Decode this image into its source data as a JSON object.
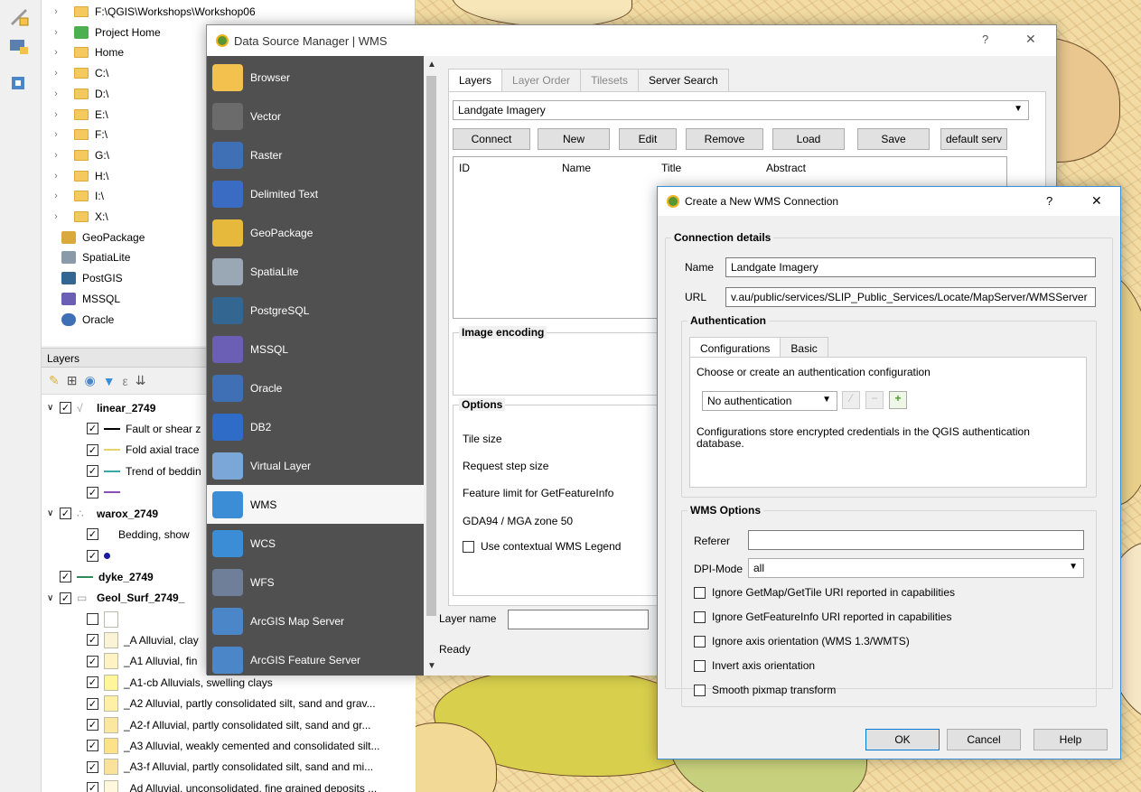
{
  "browser": {
    "items": [
      {
        "label": "F:\\QGIS\\Workshops\\Workshop06",
        "type": "folder",
        "chevron": true
      },
      {
        "label": "Project Home",
        "type": "project",
        "chevron": true
      },
      {
        "label": "Home",
        "type": "folder",
        "chevron": true
      },
      {
        "label": "C:\\",
        "type": "folder",
        "chevron": true
      },
      {
        "label": "D:\\",
        "type": "folder",
        "chevron": true
      },
      {
        "label": "E:\\",
        "type": "folder",
        "chevron": true
      },
      {
        "label": "F:\\",
        "type": "folder",
        "chevron": true
      },
      {
        "label": "G:\\",
        "type": "folder",
        "chevron": true
      },
      {
        "label": "H:\\",
        "type": "folder",
        "chevron": true
      },
      {
        "label": "I:\\",
        "type": "folder",
        "chevron": true
      },
      {
        "label": "X:\\",
        "type": "folder",
        "chevron": true
      },
      {
        "label": "GeoPackage",
        "type": "geopackage",
        "chevron": false
      },
      {
        "label": "SpatiaLite",
        "type": "spatialite",
        "chevron": false
      },
      {
        "label": "PostGIS",
        "type": "postgis",
        "chevron": false
      },
      {
        "label": "MSSQL",
        "type": "mssql",
        "chevron": false
      },
      {
        "label": "Oracle",
        "type": "oracle",
        "chevron": false
      }
    ]
  },
  "layers_panel": {
    "title": "Layers",
    "rows": [
      {
        "label": "linear_2749",
        "indent": 0,
        "bold": true,
        "checked": true,
        "expand": "v",
        "symbol": "group"
      },
      {
        "label": "Fault or shear z",
        "indent": 1,
        "checked": true,
        "symbol": "line-black"
      },
      {
        "label": "Fold axial trace",
        "indent": 1,
        "checked": true,
        "symbol": "line-yellow"
      },
      {
        "label": "Trend of beddin",
        "indent": 1,
        "checked": true,
        "symbol": "line-teal"
      },
      {
        "label": "",
        "indent": 1,
        "checked": true,
        "symbol": "line-purple"
      },
      {
        "label": "warox_2749",
        "indent": 0,
        "bold": true,
        "checked": true,
        "expand": "v",
        "symbol": "points"
      },
      {
        "label": "Bedding, show",
        "indent": 1,
        "checked": true,
        "symbol": "none"
      },
      {
        "label": "",
        "indent": 1,
        "checked": true,
        "symbol": "dot-blue"
      },
      {
        "label": "dyke_2749",
        "indent": 0,
        "bold": true,
        "checked": true,
        "expand": "",
        "symbol": "line-green"
      },
      {
        "label": "Geol_Surf_2749_",
        "indent": 0,
        "bold": true,
        "checked": true,
        "expand": "v",
        "symbol": "poly"
      },
      {
        "label": "",
        "indent": 1,
        "checked": false,
        "symbol": "sw-white"
      },
      {
        "label": "_A Alluvial, clay",
        "indent": 1,
        "checked": true,
        "symbol": "sw-cream"
      },
      {
        "label": "_A1 Alluvial, fin",
        "indent": 1,
        "checked": true,
        "symbol": "sw-cream2"
      },
      {
        "label": "_A1-cb Alluvials, swelling clays",
        "indent": 1,
        "checked": true,
        "symbol": "sw-lines"
      },
      {
        "label": "_A2 Alluvial, partly consolidated silt, sand and grav...",
        "indent": 1,
        "checked": true,
        "symbol": "sw-dots"
      },
      {
        "label": "_A2-f Alluvial, partly consolidated silt, sand and gr...",
        "indent": 1,
        "checked": true,
        "symbol": "sw-dots2"
      },
      {
        "label": "_A3 Alluvial, weakly cemented and consolidated silt...",
        "indent": 1,
        "checked": true,
        "symbol": "sw-yellow"
      },
      {
        "label": "_A3-f Alluvial, partly consolidated silt, sand and mi...",
        "indent": 1,
        "checked": true,
        "symbol": "sw-yellow2"
      },
      {
        "label": "_Ad Alluvial, unconsolidated, fine grained deposits ...",
        "indent": 1,
        "checked": true,
        "symbol": "sw-pale"
      }
    ]
  },
  "dsm": {
    "title": "Data Source Manager | WMS",
    "help": "?",
    "close": "✕",
    "sidebar": [
      {
        "label": "Browser",
        "color": "#f2c14e"
      },
      {
        "label": "Vector",
        "color": "#6b6b6b"
      },
      {
        "label": "Raster",
        "color": "#3f6fb5"
      },
      {
        "label": "Delimited Text",
        "color": "#3b6cc4"
      },
      {
        "label": "GeoPackage",
        "color": "#e6b83b"
      },
      {
        "label": "SpatiaLite",
        "color": "#9aa7b4"
      },
      {
        "label": "PostgreSQL",
        "color": "#336791"
      },
      {
        "label": "MSSQL",
        "color": "#6b5fb5"
      },
      {
        "label": "Oracle",
        "color": "#3f6fb5"
      },
      {
        "label": "DB2",
        "color": "#2f6cc8"
      },
      {
        "label": "Virtual Layer",
        "color": "#7aa6d8"
      },
      {
        "label": "WMS",
        "color": "#3b8ed6"
      },
      {
        "label": "WCS",
        "color": "#3b8ed6"
      },
      {
        "label": "WFS",
        "color": "#6f7f9a"
      },
      {
        "label": "ArcGIS Map Server",
        "color": "#4b86c8"
      },
      {
        "label": "ArcGIS Feature Server",
        "color": "#4b86c8"
      }
    ],
    "active_item": "WMS",
    "tabs": [
      {
        "label": "Layers",
        "state": "sel"
      },
      {
        "label": "Layer Order",
        "state": "dis"
      },
      {
        "label": "Tilesets",
        "state": "dis"
      },
      {
        "label": "Server Search",
        "state": ""
      }
    ],
    "connection": "Landgate Imagery",
    "buttons": [
      "Connect",
      "New",
      "Edit",
      "Remove",
      "Load",
      "Save",
      "default serv"
    ],
    "table_headers": [
      "ID",
      "Name",
      "Title",
      "Abstract"
    ],
    "image_encoding_label": "Image encoding",
    "options_label": "Options",
    "options": [
      "Tile size",
      "Request step size",
      "Feature limit for GetFeatureInfo",
      "GDA94 / MGA zone 50"
    ],
    "contextual_legend": "Use contextual WMS Legend",
    "layer_name_label": "Layer name",
    "status": "Ready"
  },
  "wms": {
    "title": "Create a New WMS Connection",
    "help": "?",
    "close": "✕",
    "connection_details": "Connection details",
    "name_label": "Name",
    "name_value": "Landgate Imagery",
    "url_label": "URL",
    "url_value": "v.au/public/services/SLIP_Public_Services/Locate/MapServer/WMSServer",
    "authentication": "Authentication",
    "auth_tabs": [
      "Configurations",
      "Basic"
    ],
    "auth_prompt": "Choose or create an authentication configuration",
    "auth_select": "No authentication",
    "auth_note": "Configurations store encrypted credentials in the QGIS authentication database.",
    "wms_options": "WMS Options",
    "referer_label": "Referer",
    "referer_value": "",
    "dpi_label": "DPI-Mode",
    "dpi_value": "all",
    "checkboxes": [
      "Ignore GetMap/GetTile URI reported in capabilities",
      "Ignore GetFeatureInfo URI reported in capabilities",
      "Ignore axis orientation (WMS 1.3/WMTS)",
      "Invert axis orientation",
      "Smooth pixmap transform"
    ],
    "ok": "OK",
    "cancel": "Cancel",
    "help_btn": "Help"
  },
  "colors": {
    "dsm_sidebar": "#505050",
    "accent": "#3c8dd6",
    "qgis_green": "#589632"
  }
}
